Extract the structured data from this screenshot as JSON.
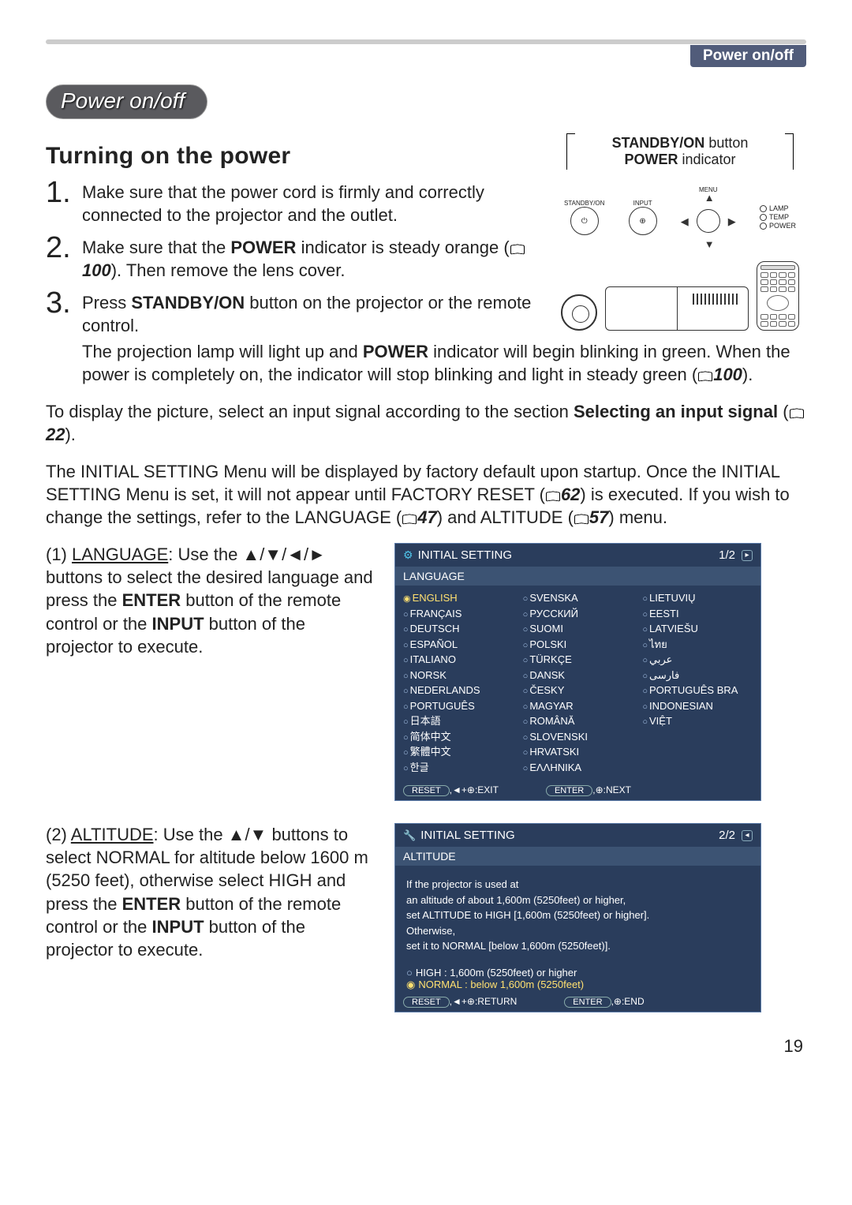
{
  "header": {
    "section_tab": "Power on/off",
    "pill": "Power on/off"
  },
  "title": "Turning on the power",
  "callout": {
    "line1_bold": "STANDBY/ON",
    "line1_rest": " button",
    "line2_bold": "POWER",
    "line2_rest": " indicator"
  },
  "diagram_labels": {
    "standby": "STANDBY/ON",
    "input": "INPUT",
    "menu": "MENU",
    "lamp": "LAMP",
    "temp": "TEMP",
    "power": "POWER"
  },
  "steps": {
    "s1": "Make sure that the power cord is firmly and correctly connected to the projector and the outlet.",
    "s2a": "Make sure that the ",
    "s2b": "POWER",
    "s2c": " indicator is steady orange (",
    "s2ref": "100",
    "s2d": "). Then remove the lens cover.",
    "s3a": "Press ",
    "s3b": "STANDBY/ON",
    "s3c": " button on the projector or the remote control.",
    "s3p2a": "The projection lamp will light up and ",
    "s3p2b": "POWER",
    "s3p2c": " indicator will begin blinking in green. When the power is completely on, the indicator will stop blinking and light in steady green (",
    "s3ref": "100",
    "s3p2d": ")."
  },
  "para1": {
    "a": "To display the picture, select an input signal according to the section ",
    "b": "Selecting an input signal",
    "c": " (",
    "ref": "22",
    "d": ")."
  },
  "para2": {
    "a": "The INITIAL SETTING Menu will be displayed by factory default upon startup. Once the INITIAL SETTING Menu is set, it will not appear until FACTORY RESET (",
    "ref1": "62",
    "b": ") is executed. If you wish to change the settings, refer to the LANGUAGE (",
    "ref2": "47",
    "c": ") and ALTITUDE (",
    "ref3": "57",
    "d": ") menu."
  },
  "item1": {
    "label": "(1) ",
    "head": "LANGUAGE",
    "a": ": Use the ▲/▼/◄/► buttons to select the desired language and press the ",
    "b": "ENTER",
    "c": " button of the remote control or the ",
    "d": "INPUT",
    "e": " button of the projector to execute."
  },
  "item2": {
    "label": "(2) ",
    "head": "ALTITUDE",
    "a": ": Use the ▲/▼ buttons to select NORMAL for altitude below 1600 m (5250 feet), otherwise select HIGH and press the ",
    "b": "ENTER",
    "c": " button of the remote control or the ",
    "d": "INPUT",
    "e": " button of the projector to execute."
  },
  "osd1": {
    "title": "INITIAL SETTING",
    "page": "1/2",
    "subtitle": "LANGUAGE",
    "col1": [
      "ENGLISH",
      "FRANÇAIS",
      "DEUTSCH",
      "ESPAÑOL",
      "ITALIANO",
      "NORSK",
      "NEDERLANDS",
      "PORTUGUÊS",
      "日本語",
      "简体中文",
      "繁體中文",
      "한글"
    ],
    "col2": [
      "SVENSKA",
      "РУССКИЙ",
      "SUOMI",
      "POLSKI",
      "TÜRKÇE",
      "DANSK",
      "ČESKY",
      "MAGYAR",
      "ROMÂNĂ",
      "SLOVENSKI",
      "HRVATSKI",
      "ΕΛΛΗΝΙΚΑ"
    ],
    "col3": [
      "LIETUVIŲ",
      "EESTI",
      "LATVIEŠU",
      "ไทย",
      "عربي",
      "فارسی",
      "PORTUGUÊS BRA",
      "INDONESIAN",
      "VIỆT"
    ],
    "footer_left_btn": "RESET",
    "footer_left_txt": ",◄+⊕:EXIT",
    "footer_right_btn": "ENTER",
    "footer_right_txt": ",⊕:NEXT"
  },
  "osd2": {
    "title": "INITIAL SETTING",
    "page": "2/2",
    "subtitle": "ALTITUDE",
    "body_l1": "If the projector is used at",
    "body_l2": "an altitude of about 1,600m (5250feet) or higher,",
    "body_l3": "set ALTITUDE to HIGH [1,600m (5250feet) or higher].",
    "body_l4": "Otherwise,",
    "body_l5": "set it to NORMAL [below 1,600m (5250feet)].",
    "opt_high": "HIGH     : 1,600m (5250feet) or higher",
    "opt_norm": "NORMAL : below 1,600m (5250feet)",
    "footer_left_btn": "RESET",
    "footer_left_txt": ",◄+⊕:RETURN",
    "footer_right_btn": "ENTER",
    "footer_right_txt": ",⊕:END"
  },
  "page_number": "19"
}
